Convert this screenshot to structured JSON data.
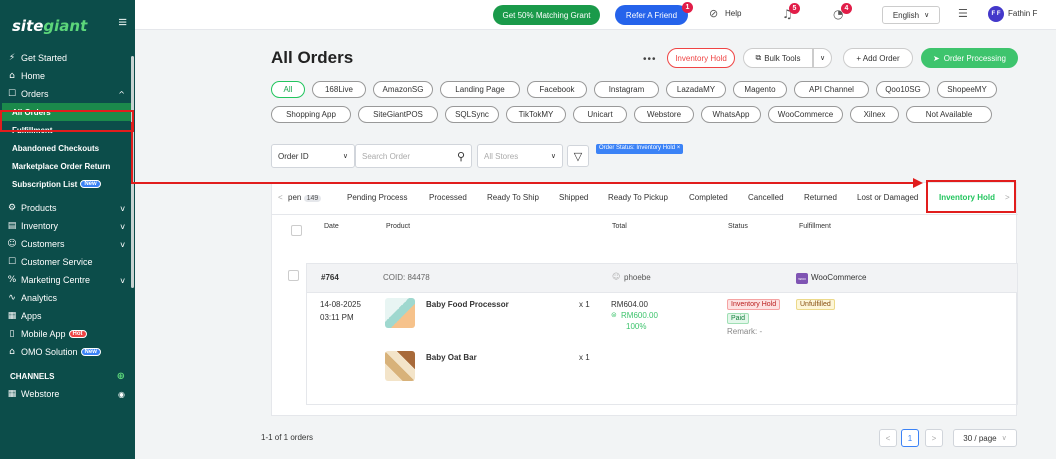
{
  "sidebar": {
    "logo_a": "site",
    "logo_b": "giant",
    "hamburger": "≡",
    "items": [
      {
        "icon": "⚡",
        "label": "Get Started"
      },
      {
        "icon": "⌂",
        "label": "Home"
      },
      {
        "icon": "☐",
        "label": "Orders",
        "chev": "^"
      }
    ],
    "order_subs": [
      "All Orders",
      "Fulfillment",
      "Abandoned Checkouts",
      "Marketplace Order Return",
      "Subscription List"
    ],
    "new_badge": "New",
    "hot_badge": "Hot",
    "items2": [
      {
        "icon": "⚙",
        "label": "Products",
        "chev": "v"
      },
      {
        "icon": "▤",
        "label": "Inventory",
        "chev": "v"
      },
      {
        "icon": "☺",
        "label": "Customers",
        "chev": "v"
      },
      {
        "icon": "☐",
        "label": "Customer Service"
      },
      {
        "icon": "%",
        "label": "Marketing Centre",
        "chev": "v"
      },
      {
        "icon": "∿",
        "label": "Analytics"
      },
      {
        "icon": "▦",
        "label": "Apps"
      },
      {
        "icon": "▯",
        "label": "Mobile App"
      },
      {
        "icon": "⌂",
        "label": "OMO Solution"
      }
    ],
    "channels_label": "CHANNELS",
    "channels_add": "⊕",
    "webstore_label": "Webstore",
    "webstore_icon": "◉"
  },
  "topbar": {
    "grant_label": "Get 50% Matching Grant",
    "refer_label": "Refer A Friend",
    "refer_count": "1",
    "help_label": "Help",
    "bell_count": "5",
    "timer_count": "4",
    "language": "English",
    "avatar_initials": "F F",
    "user_name": "Fathin F"
  },
  "page": {
    "title": "All Orders",
    "more": "•••",
    "inventory_hold_btn": "Inventory Hold",
    "bulk_tools_btn": "Bulk Tools",
    "add_order_btn": "+ Add Order",
    "order_processing_btn": "Order Processing"
  },
  "channels": {
    "row1": [
      "All",
      "168Live",
      "AmazonSG",
      "Landing Page",
      "Facebook",
      "Instagram",
      "LazadaMY",
      "Magento",
      "API Channel",
      "Qoo10SG",
      "ShopeeMY"
    ],
    "row2": [
      "Shopping App",
      "SiteGiantPOS",
      "SQLSync",
      "TikTokMY",
      "Unicart",
      "Webstore",
      "WhatsApp",
      "WooCommerce",
      "Xilnex",
      "Not Available"
    ]
  },
  "filters": {
    "field": "Order ID",
    "search_placeholder": "Search Order",
    "stores_placeholder": "All Stores",
    "status_tag": "Order Status: Inventory Hold ×"
  },
  "tabs": {
    "open_label": "pen",
    "open_count": "149",
    "items": [
      "Pending Process",
      "Processed",
      "Ready To Ship",
      "Shipped",
      "Ready To Pickup",
      "Completed",
      "Cancelled",
      "Returned",
      "Lost or Damaged",
      "Inventory Hold"
    ]
  },
  "table": {
    "headers": [
      "Date",
      "Product",
      "Total",
      "Status",
      "Fulfillment"
    ]
  },
  "order": {
    "number": "#764",
    "coid": "COID: 84478",
    "customer": "phoebe",
    "channel": "WooCommerce",
    "channel_logo": "woo",
    "date": "14-08-2025",
    "time": "03:11 PM",
    "items": [
      {
        "name": "Baby Food Processor",
        "qty": "x 1"
      },
      {
        "name": "Baby Oat Bar",
        "qty": "x 1"
      }
    ],
    "total": "RM604.00",
    "paid_amount": "RM600.00",
    "paid_pct": "100%",
    "status_hold": "Inventory Hold",
    "status_paid": "Paid",
    "remark": "Remark: -",
    "fulfillment": "Unfulfilled"
  },
  "footer": {
    "count_label": "1-1 of 1 orders",
    "page_current": "1",
    "page_size": "30 / page"
  }
}
